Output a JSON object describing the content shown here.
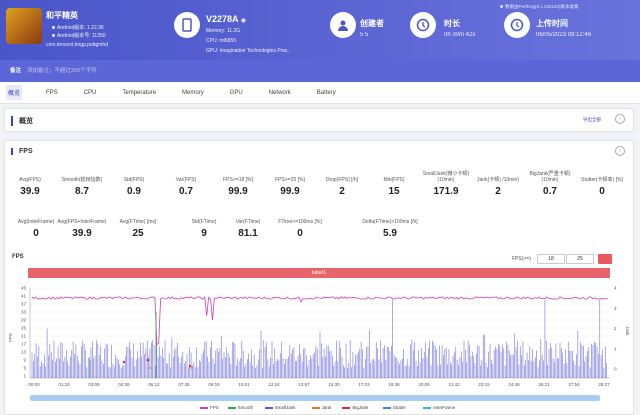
{
  "app": {
    "name": "和平精英",
    "android_version": "Android版本: 1.22.36",
    "android_code": "Android版本号: 11350",
    "package": "com.tencent.tmgp.pubgmhd"
  },
  "device": {
    "name": "V2278A",
    "memory": "Memory: 11.3G",
    "cpu": "CPU: mt6855",
    "gpu": "GPU: Imagination Technologies Pow..."
  },
  "creator": {
    "label": "创建者",
    "value": "5 5"
  },
  "duration": {
    "label": "时长",
    "value": "0h 30m 42s"
  },
  "upload": {
    "label": "上传时间",
    "value": "06/05/2023 09:12:46"
  },
  "version_note": "数据由PerfDog(8.1.230120)版本收集",
  "note": {
    "label": "备注",
    "placeholder": "添加备注，不超过200个字符"
  },
  "tabs": [
    "概览",
    "FPS",
    "CPU",
    "Temperature",
    "Memory",
    "GPU",
    "Network",
    "Battery"
  ],
  "overview": {
    "title": "概览",
    "export": "导出全部"
  },
  "fps_section": {
    "title": "FPS"
  },
  "metrics_row1": [
    {
      "label": "Avg(FPS)",
      "value": "39.9"
    },
    {
      "label": "Smooth(稳帧指数)",
      "value": "8.7"
    },
    {
      "label": "Std(FPS)",
      "value": "0.9"
    },
    {
      "label": "Var(FPS)",
      "value": "0.7"
    },
    {
      "label": "FPS>=18 [%]",
      "value": "99.9"
    },
    {
      "label": "FPS>=25 [%]",
      "value": "99.9"
    },
    {
      "label": "Drop(FPS) [/h]",
      "value": "2"
    },
    {
      "label": "Min(FPS)",
      "value": "15"
    },
    {
      "label": "SmallJank(微小卡顿) /10min)",
      "value": "171.9"
    },
    {
      "label": "Jank(卡顿) /10min)",
      "value": "2"
    },
    {
      "label": "BigJank(严重卡顿) /10min)",
      "value": "0.7"
    },
    {
      "label": "Stutter(卡顿率) [%]",
      "value": "0"
    }
  ],
  "metrics_row2": [
    {
      "label": "Avg(InterFrame)",
      "value": "0"
    },
    {
      "label": "Avg(FPS+InterFrame)",
      "value": "39.9"
    },
    {
      "label": "Avg(FTime) [ms]",
      "value": "25"
    },
    {
      "label": "Std(FTime)",
      "value": "9"
    },
    {
      "label": "Var(FTime)",
      "value": "81.1"
    },
    {
      "label": "FTime>=100ms [%]",
      "value": "0"
    },
    {
      "label": "Delta(FTime)>100ms [/h]",
      "value": "5.9"
    }
  ],
  "chart_controls": {
    "title": "FPS",
    "fps_ge": "FPS(>=)",
    "v1": "18",
    "v2": "25",
    "label": "label1"
  },
  "chart_data": {
    "type": "line",
    "y_left_label": "FPS",
    "y_right_label": "Jank",
    "y_left_ticks": [
      "45",
      "41",
      "37",
      "33",
      "29",
      "25",
      "21",
      "17",
      "13",
      "9",
      "5",
      "1"
    ],
    "y_right_ticks": [
      "4",
      "3",
      "2",
      "1",
      "0"
    ],
    "x_ticks": [
      "00:00",
      "01:33",
      "03:06",
      "04:39",
      "06:12",
      "07:45",
      "09:18",
      "10:51",
      "12:24",
      "13:57",
      "15:30",
      "17:03",
      "18:36",
      "20:09",
      "21:42",
      "23:15",
      "24:48",
      "26:21",
      "27:54",
      "29:27"
    ],
    "ylim": [
      0,
      45
    ],
    "series": [
      {
        "name": "FPS",
        "color": "#d23fb0",
        "typical": 40
      },
      {
        "name": "Smooth",
        "color": "#3aa04a"
      },
      {
        "name": "SmallJank",
        "color": "#5a5ad8"
      },
      {
        "name": "Jank",
        "color": "#e57a2c"
      },
      {
        "name": "BigJank",
        "color": "#d83030"
      },
      {
        "name": "Stutter",
        "color": "#4a7de0"
      },
      {
        "name": "InterFrame",
        "color": "#3fb6d6"
      }
    ]
  }
}
